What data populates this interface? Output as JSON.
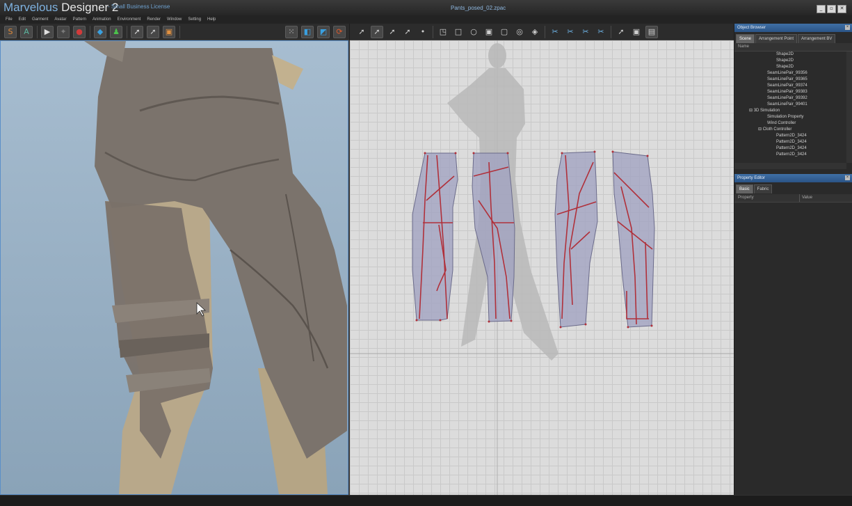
{
  "app": {
    "name_brand": "Marvelous",
    "name_rest": " Designer 2",
    "license": "-   Small Business License",
    "file": "Pants_posed_02.zpac",
    "window_buttons": [
      "_",
      "▫",
      "✕"
    ]
  },
  "menu": [
    "File",
    "Edit",
    "Garment",
    "Avatar",
    "Pattern",
    "Animation",
    "Environment",
    "Render",
    "Window",
    "Setting",
    "Help"
  ],
  "toolbar3d": {
    "tools": [
      {
        "name": "simulation-s-icon",
        "glyph": "S",
        "color": "#e08a3a"
      },
      {
        "name": "animation-a-icon",
        "glyph": "A",
        "color": "#5bb7a0"
      },
      {
        "name": "play-icon",
        "glyph": "▶",
        "color": "#e0e0e0"
      },
      {
        "name": "walk-icon",
        "glyph": "✦",
        "color": "#7a7a7a"
      },
      {
        "name": "record-icon",
        "glyph": "●",
        "color": "#d23a3a"
      },
      {
        "name": "garment-shirt-icon",
        "glyph": "◆",
        "color": "#3aa0e0"
      },
      {
        "name": "avatar-icon",
        "glyph": "♟",
        "color": "#4cc24c"
      },
      {
        "name": "select-arrow-icon",
        "glyph": "➚",
        "color": "#e0e0e0"
      },
      {
        "name": "select-mesh-icon",
        "glyph": "➚",
        "color": "#cfcfcf"
      },
      {
        "name": "pin-box-icon",
        "glyph": "▣",
        "color": "#e09040"
      },
      {
        "name": "grid-dots-icon",
        "glyph": "⁙",
        "color": "#e0e0e0"
      },
      {
        "name": "layer-icon",
        "glyph": "◧",
        "color": "#3aa0e0"
      },
      {
        "name": "texture-icon",
        "glyph": "◩",
        "color": "#3aa0e0"
      },
      {
        "name": "reset-icon",
        "glyph": "⟳",
        "color": "#e05a2a"
      }
    ]
  },
  "toolbar2d": {
    "tools": [
      {
        "name": "transform-pattern-icon",
        "glyph": "➚"
      },
      {
        "name": "select-icon",
        "glyph": "➚"
      },
      {
        "name": "edit-point-icon",
        "glyph": "➚"
      },
      {
        "name": "edit-curve-icon",
        "glyph": "➚"
      },
      {
        "name": "add-point-icon",
        "glyph": "•"
      },
      {
        "name": "polygon-icon",
        "glyph": "◳"
      },
      {
        "name": "rectangle-icon",
        "glyph": "□"
      },
      {
        "name": "circle-icon",
        "glyph": "○"
      },
      {
        "name": "internal-polygon-icon",
        "glyph": "▣"
      },
      {
        "name": "internal-rect-icon",
        "glyph": "▢"
      },
      {
        "name": "internal-circle-icon",
        "glyph": "◎"
      },
      {
        "name": "dart-icon",
        "glyph": "◈"
      },
      {
        "name": "seam-segment-icon",
        "glyph": "✂"
      },
      {
        "name": "seam-free-icon",
        "glyph": "✂"
      },
      {
        "name": "seam-multi-icon",
        "glyph": "✂"
      },
      {
        "name": "tack-icon",
        "glyph": "✂"
      },
      {
        "name": "select-mesh2d-icon",
        "glyph": "➚"
      },
      {
        "name": "pin-box2d-icon",
        "glyph": "▣"
      },
      {
        "name": "screenshot-icon",
        "glyph": "▤"
      }
    ]
  },
  "object_browser": {
    "title": "Object Browser",
    "tabs": [
      "Scene",
      "Arrangement Point",
      "Arrangement BV"
    ],
    "column": "Name",
    "rows": [
      {
        "indent": 4,
        "label": "Shape2D"
      },
      {
        "indent": 4,
        "label": "Shape2D"
      },
      {
        "indent": 4,
        "label": "Shape2D"
      },
      {
        "indent": 3,
        "label": "SeamLinePair_99356"
      },
      {
        "indent": 3,
        "label": "SeamLinePair_99365"
      },
      {
        "indent": 3,
        "label": "SeamLinePair_99374"
      },
      {
        "indent": 3,
        "label": "SeamLinePair_99383"
      },
      {
        "indent": 3,
        "label": "SeamLinePair_99392"
      },
      {
        "indent": 3,
        "label": "SeamLinePair_99401"
      },
      {
        "indent": 1,
        "label": "⊟ 3D Simulation"
      },
      {
        "indent": 3,
        "label": "Simulation Property"
      },
      {
        "indent": 3,
        "label": "Wind Controller"
      },
      {
        "indent": 2,
        "label": "⊟ Cloth Controller"
      },
      {
        "indent": 4,
        "label": "Pattern2D_3424"
      },
      {
        "indent": 4,
        "label": "Pattern2D_3424"
      },
      {
        "indent": 4,
        "label": "Pattern2D_3424"
      },
      {
        "indent": 4,
        "label": "Pattern2D_3424"
      }
    ]
  },
  "property_editor": {
    "title": "Property Editor",
    "tabs": [
      "Basic",
      "Fabric"
    ],
    "columns": [
      "Property",
      "Value"
    ]
  }
}
